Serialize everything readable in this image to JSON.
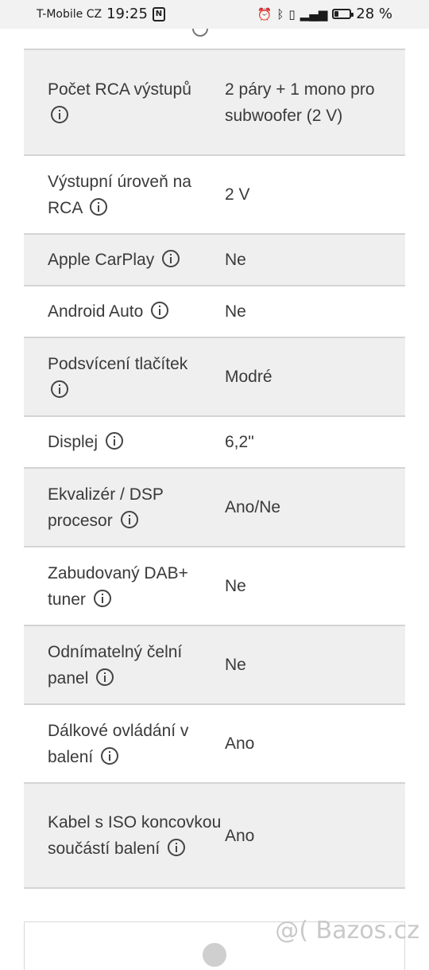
{
  "status_bar": {
    "carrier": "T-Mobile CZ",
    "time": "19:25",
    "nfc_glyph": "N",
    "battery_percent": "28 %",
    "battery_level": 0.28,
    "icons": [
      "alarm-icon",
      "bluetooth-icon",
      "vibrate-icon",
      "lte-signal-icon",
      "battery-icon"
    ]
  },
  "specs": [
    {
      "label": "Počet RCA výstupů",
      "value": "2 páry + 1 mono pro subwoofer (2 V)"
    },
    {
      "label": "Výstupní úroveň na RCA",
      "value": "2 V"
    },
    {
      "label": "Apple CarPlay",
      "value": "Ne"
    },
    {
      "label": "Android Auto",
      "value": "Ne"
    },
    {
      "label": "Podsvícení tlačítek",
      "value": "Modré"
    },
    {
      "label": "Displej",
      "value": "6,2\""
    },
    {
      "label": "Ekvalizér / DSP procesor",
      "value": "Ano/Ne"
    },
    {
      "label": "Zabudovaný DAB+ tuner",
      "value": "Ne"
    },
    {
      "label": "Odnímatelný čelní panel",
      "value": "Ne"
    },
    {
      "label": "Dálkové ovládání v balení",
      "value": "Ano"
    },
    {
      "label": "Kabel s ISO koncovkou součástí balení",
      "value": "Ano"
    }
  ],
  "watermark": "@( Bazos.cz",
  "colors": {
    "row_shade": "#efefef",
    "divider": "#d4d4d4",
    "text": "#3a3a3a"
  }
}
